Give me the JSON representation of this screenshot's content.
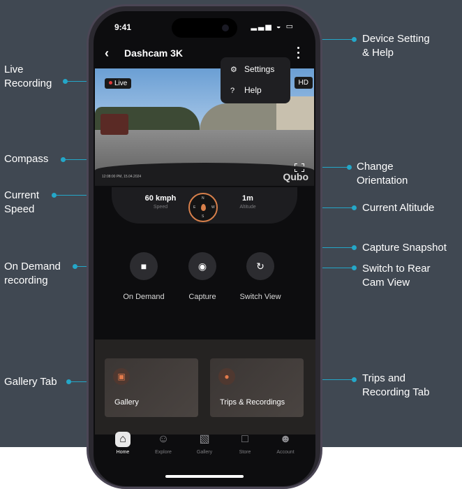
{
  "status_bar": {
    "time": "9:41",
    "signal": "▂▃▅ ◒ ▭"
  },
  "header": {
    "back_icon": "‹",
    "title": "Dashcam 3K"
  },
  "menu": {
    "items": [
      {
        "icon": "⚙",
        "label": "Settings"
      },
      {
        "icon": "?",
        "label": "Help"
      }
    ]
  },
  "video": {
    "live_badge": "Live",
    "quality_badge": "HD",
    "timestamp": "12:08:00 PM, 15.04.2024",
    "watermark": "Qubo"
  },
  "stats": {
    "speed_value": "60 kmph",
    "speed_label": "Speed",
    "altitude_value": "1m",
    "altitude_label": "Altitude",
    "compass": {
      "n": "N",
      "s": "S",
      "e": "E",
      "w": "W"
    }
  },
  "actions": [
    {
      "icon": "■",
      "label": "On Demand"
    },
    {
      "icon": "◉",
      "label": "Capture"
    },
    {
      "icon": "↻",
      "label": "Switch View"
    }
  ],
  "cards": [
    {
      "icon": "▣",
      "label": "Gallery"
    },
    {
      "icon": "●",
      "label": "Trips & Recordings"
    }
  ],
  "tabs": [
    {
      "icon": "⌂",
      "label": "Home",
      "active": true
    },
    {
      "icon": "☺",
      "label": "Explore"
    },
    {
      "icon": "▧",
      "label": "Gallery"
    },
    {
      "icon": "□",
      "label": "Store"
    },
    {
      "icon": "☻",
      "label": "Account"
    }
  ],
  "callouts": {
    "live_recording": "Live\nRecording",
    "device_setting": "Device Setting\n& Help",
    "compass": "Compass",
    "change_orientation": "Change\nOrientation",
    "current_speed": "Current\nSpeed",
    "current_altitude": "Current Altitude",
    "capture_snapshot": "Capture Snapshot",
    "on_demand": "On Demand\nrecording",
    "switch_rear": "Switch to Rear\nCam View",
    "gallery_tab": "Gallery Tab",
    "trips_tab": "Trips and\nRecording Tab"
  },
  "colors": {
    "background": "#404852",
    "accent_line": "#24a7c8",
    "brand_orange": "#d8804b"
  }
}
